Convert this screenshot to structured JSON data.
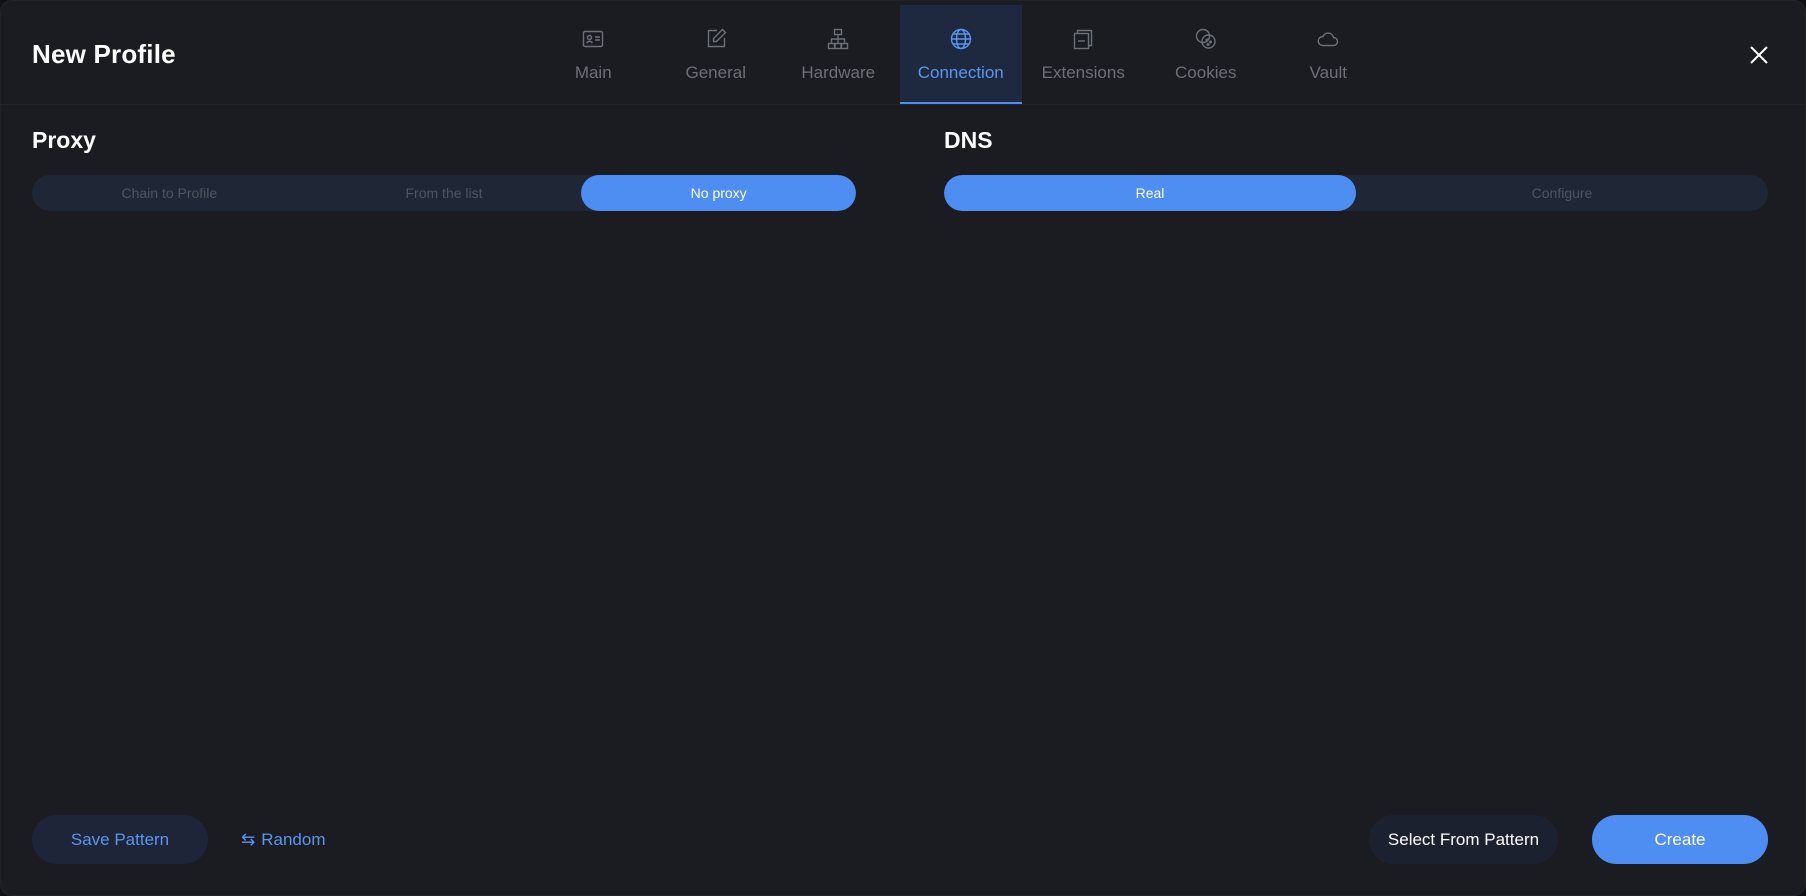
{
  "header": {
    "title": "New Profile",
    "tabs": [
      {
        "label": "Main",
        "icon": "id-card-icon",
        "active": false
      },
      {
        "label": "General",
        "icon": "edit-icon",
        "active": false
      },
      {
        "label": "Hardware",
        "icon": "network-hierarchy-icon",
        "active": false
      },
      {
        "label": "Connection",
        "icon": "globe-icon",
        "active": true
      },
      {
        "label": "Extensions",
        "icon": "stacked-windows-icon",
        "active": false
      },
      {
        "label": "Cookies",
        "icon": "cookie-icon",
        "active": false
      },
      {
        "label": "Vault",
        "icon": "cloud-icon",
        "active": false
      }
    ],
    "close_icon": "close-icon"
  },
  "proxy": {
    "title": "Proxy",
    "options": [
      {
        "label": "Chain to Profile",
        "selected": false
      },
      {
        "label": "From the list",
        "selected": false
      },
      {
        "label": "No proxy",
        "selected": true
      }
    ]
  },
  "dns": {
    "title": "DNS",
    "options": [
      {
        "label": "Real",
        "selected": true
      },
      {
        "label": "Configure",
        "selected": false
      }
    ]
  },
  "footer": {
    "save_label": "Save Pattern",
    "random_label": "Random",
    "random_icon": "swap-arrows-icon",
    "select_label": "Select From Pattern",
    "create_label": "Create"
  },
  "colors": {
    "accent": "#4e8ef2",
    "background": "#1a1c22",
    "segment_bg": "#1f2635",
    "inactive_text": "#6c7079"
  }
}
